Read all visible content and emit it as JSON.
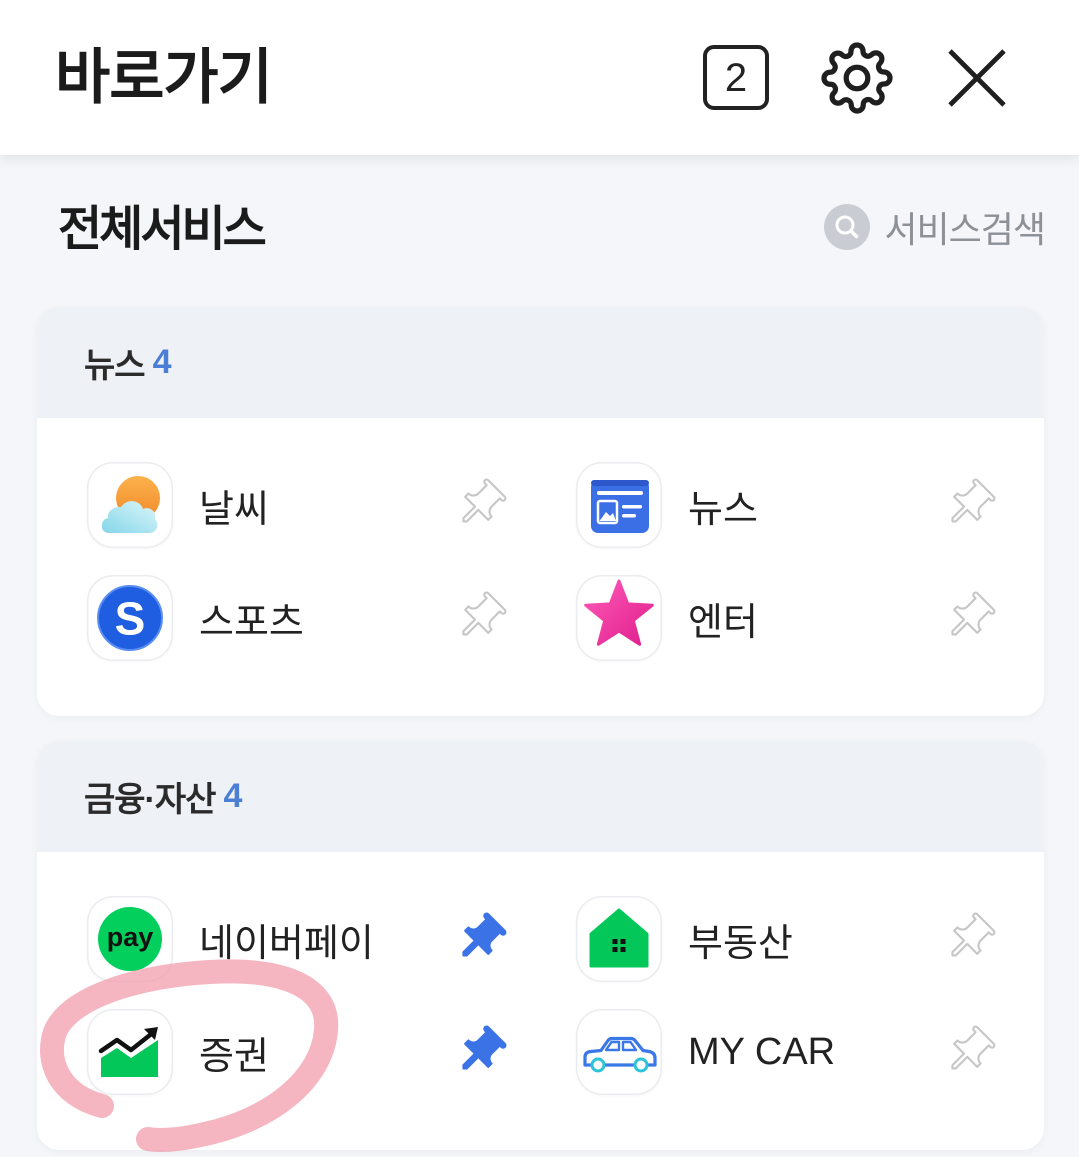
{
  "header": {
    "title": "바로가기",
    "tab_count": "2",
    "settings_icon": "gear-icon",
    "close_icon": "close-icon"
  },
  "all_services": {
    "title": "전체서비스",
    "search_icon": "search-icon",
    "search_label": "서비스검색"
  },
  "sections": [
    {
      "title": "뉴스",
      "count": "4",
      "items": [
        {
          "label": "날씨",
          "icon": "weather-icon",
          "pinned": false
        },
        {
          "label": "뉴스",
          "icon": "news-icon",
          "pinned": false
        },
        {
          "label": "스포츠",
          "icon": "sports-icon",
          "logo_text": "S",
          "pinned": false
        },
        {
          "label": "엔터",
          "icon": "star-icon",
          "pinned": false
        }
      ]
    },
    {
      "title": "금융·자산",
      "count": "4",
      "items": [
        {
          "label": "네이버페이",
          "icon": "naver-pay-icon",
          "logo_text": "pay",
          "pinned": true
        },
        {
          "label": "부동산",
          "icon": "house-icon",
          "pinned": false
        },
        {
          "label": "증권",
          "icon": "stock-chart-icon",
          "pinned": true
        },
        {
          "label": "MY CAR",
          "icon": "car-icon",
          "pinned": false
        }
      ]
    }
  ],
  "colors": {
    "count": "#4b7fd6",
    "pin_active": "#3b73e6",
    "naver_green": "#03c75a",
    "annotation": "#f19aa9"
  }
}
